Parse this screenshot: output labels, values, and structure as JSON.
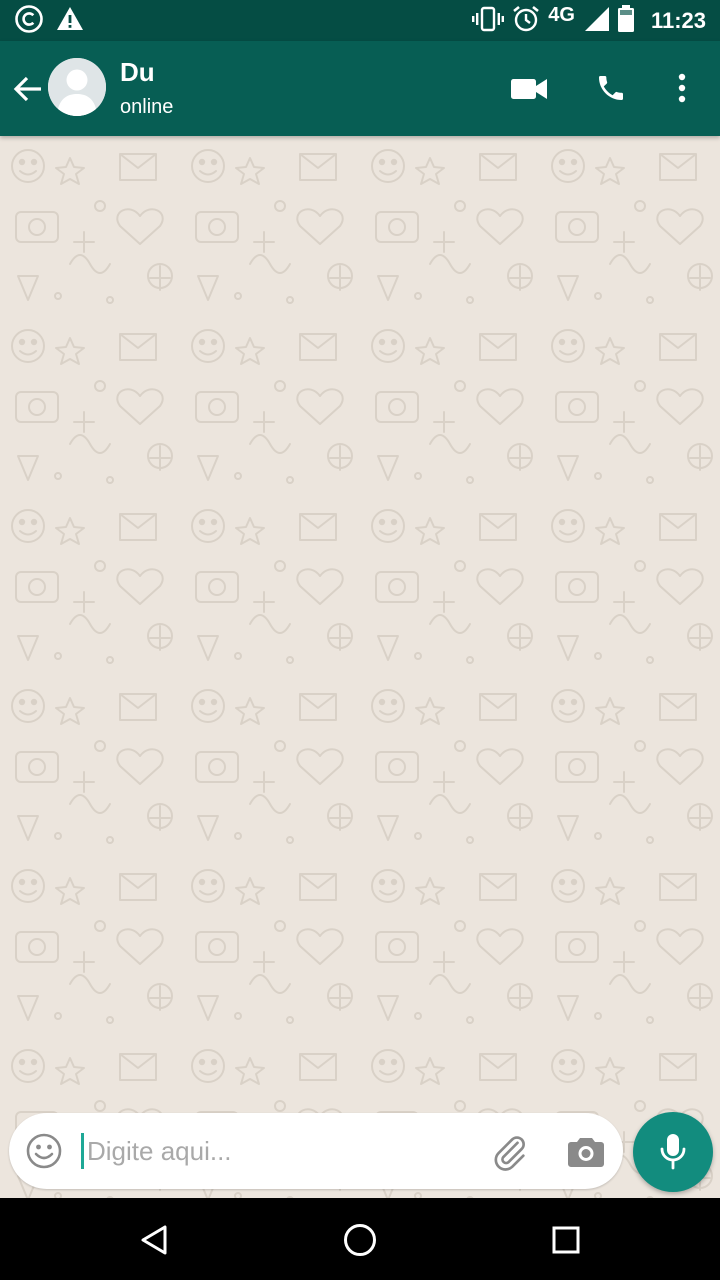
{
  "status_bar": {
    "left_icons": [
      "copyright-icon",
      "warning-icon"
    ],
    "right_icons": [
      "vibrate-icon",
      "alarm-icon",
      "signal-icon",
      "battery-icon"
    ],
    "network": "4G",
    "time": "11:23"
  },
  "toolbar": {
    "back_icon": "arrow-back-icon",
    "contact_name": "Du",
    "contact_status": "online",
    "actions": [
      "video-call-icon",
      "voice-call-icon",
      "more-vert-icon"
    ]
  },
  "composer": {
    "placeholder": "Digite aqui...",
    "value": "",
    "icons": [
      "emoji-icon",
      "attach-icon",
      "camera-icon",
      "mic-icon"
    ]
  },
  "nav_bar": {
    "icons": [
      "back-triangle-icon",
      "home-circle-icon",
      "recents-square-icon"
    ]
  },
  "colors": {
    "status_bar": "#054d44",
    "toolbar": "#075e54",
    "chat_background": "#ece5dd",
    "accent": "#128c7e",
    "caret": "#1ea896"
  }
}
